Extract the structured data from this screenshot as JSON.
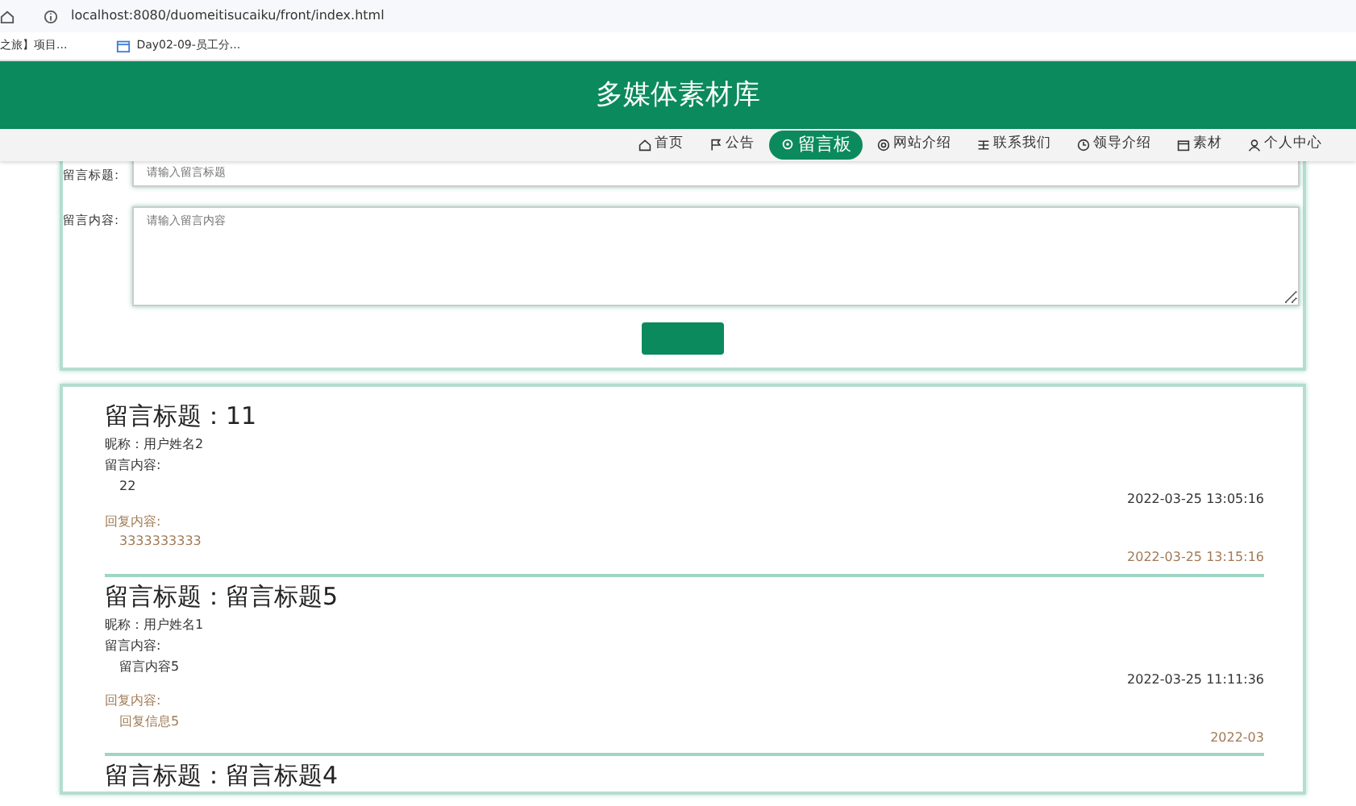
{
  "browser": {
    "url": "localhost:8080/duomeitisucaiku/front/index.html",
    "bookmarks": [
      {
        "label": "之旅】项目...",
        "kind": "text"
      },
      {
        "label": "Day02-09-员工分...",
        "kind": "calendar"
      }
    ]
  },
  "header": {
    "title": "多媒体素材库"
  },
  "nav": [
    {
      "label": "首页",
      "selected": false
    },
    {
      "label": "公告",
      "selected": false
    },
    {
      "label": "留言板",
      "selected": true
    },
    {
      "label": "网站介绍",
      "selected": false
    },
    {
      "label": "联系我们",
      "selected": false
    },
    {
      "label": "领导介绍",
      "selected": false
    },
    {
      "label": "素材",
      "selected": false
    },
    {
      "label": "个人中心",
      "selected": false
    }
  ],
  "form": {
    "title_label": "留言标题:",
    "title_placeholder": "请输入留言标题",
    "content_label": "留言内容:",
    "content_placeholder": "请输入留言内容"
  },
  "messages": [
    {
      "title": "留言标题：11",
      "nickname": "昵称：用户姓名2",
      "content_label": "留言内容:",
      "content": "22",
      "time": "2022-03-25 13:05:16",
      "reply_label": "回复内容:",
      "reply": "3333333333",
      "reply_time": "2022-03-25 13:15:16"
    },
    {
      "title": "留言标题：留言标题5",
      "nickname": "昵称：用户姓名1",
      "content_label": "留言内容:",
      "content": "留言内容5",
      "time": "2022-03-25 11:11:36",
      "reply_label": "回复内容:",
      "reply": "回复信息5",
      "reply_time": "2022-03"
    },
    {
      "title": "留言标题：留言标题4"
    }
  ]
}
